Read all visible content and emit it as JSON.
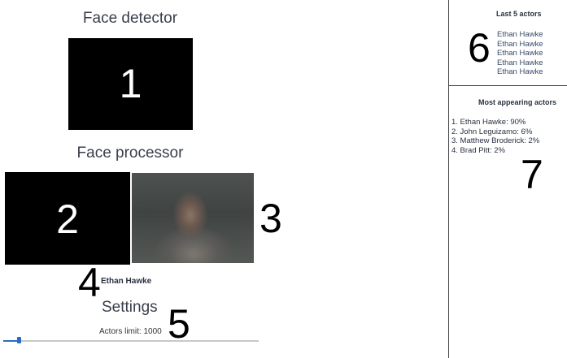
{
  "detector": {
    "title": "Face detector",
    "number": "1"
  },
  "processor": {
    "title": "Face processor",
    "left_number": "2",
    "photo_number": "3",
    "photo_desc": "face crop photo"
  },
  "recognition": {
    "actor_name": "Ethan Hawke",
    "number": "4"
  },
  "settings": {
    "title": "Settings",
    "limit_label": "Actors limit: 1000",
    "number": "5",
    "slider_level": 0.06
  },
  "last_actors": {
    "title": "Last 5 actors",
    "number": "6",
    "items": [
      "Ethan Hawke",
      "Ethan Hawke",
      "Ethan Hawke",
      "Ethan Hawke",
      "Ethan Hawke"
    ]
  },
  "most_appearing": {
    "title": "Most appearing actors",
    "number": "7",
    "items": [
      "1. Ethan Hawke: 90%",
      "2. John Leguizamo: 6%",
      "3. Matthew Broderick: 2%",
      "4. Brad Pitt: 2%"
    ]
  }
}
